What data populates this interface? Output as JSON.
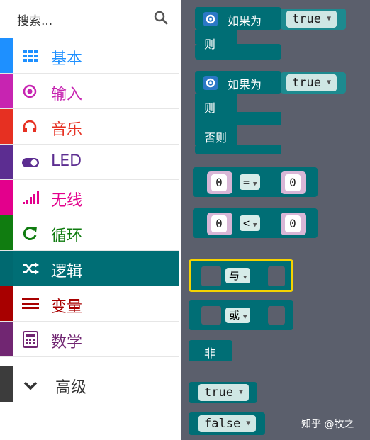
{
  "search": {
    "placeholder": "搜索..."
  },
  "categories": [
    {
      "label": "基本",
      "icon": "grid-icon",
      "color": "#1e90ff"
    },
    {
      "label": "输入",
      "icon": "target-icon",
      "color": "#c724b1"
    },
    {
      "label": "音乐",
      "icon": "headphones-icon",
      "color": "#e63022"
    },
    {
      "label": "LED",
      "icon": "toggle-icon",
      "color": "#5c2d91"
    },
    {
      "label": "无线",
      "icon": "signal-bars-icon",
      "color": "#e3008c"
    },
    {
      "label": "循环",
      "icon": "refresh-icon",
      "color": "#107c10"
    },
    {
      "label": "逻辑",
      "icon": "shuffle-icon",
      "color": "#006970"
    },
    {
      "label": "变量",
      "icon": "list-icon",
      "color": "#a80000"
    },
    {
      "label": "数学",
      "icon": "calculator-icon",
      "color": "#712672"
    },
    {
      "label": "高级",
      "icon": "chevron-down-icon",
      "color": "#3c3c3c"
    }
  ],
  "blocks": {
    "if_label": "如果为",
    "then_label": "则",
    "else_label": "否则",
    "true_value": "true",
    "false_value": "false",
    "zero": "0",
    "equals_op": "=",
    "less_op": "<",
    "and_op": "与",
    "or_op": "或",
    "not_label": "非"
  },
  "watermark": "知乎 @牧之"
}
